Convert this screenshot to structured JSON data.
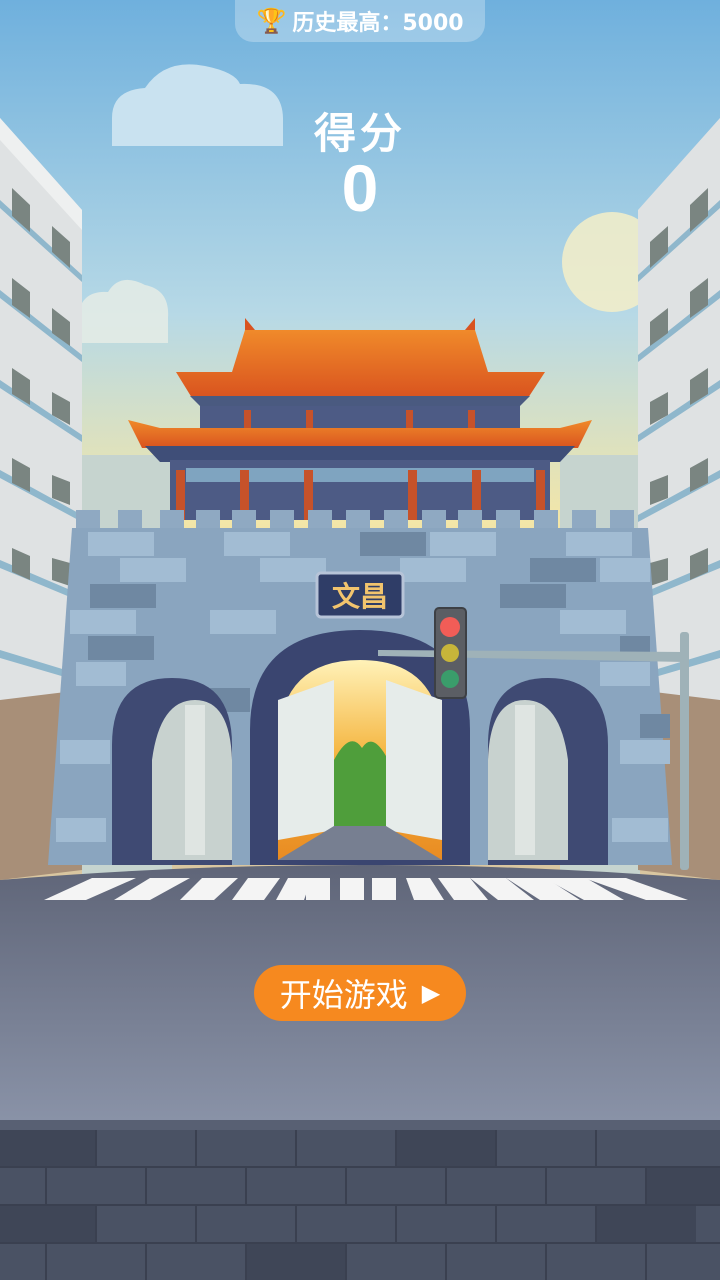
{
  "hud": {
    "best_label": "历史最高：5000",
    "score_label": "得分",
    "score_value": "0"
  },
  "gate": {
    "plaque_text": "文昌"
  },
  "buttons": {
    "start_label": "开始游戏"
  },
  "icons": {
    "best": "trophy-icon",
    "start": "play-icon"
  },
  "colors": {
    "sky_top": "#6fb0dd",
    "sky_bottom": "#f3e6a8",
    "roof": "#e0612a",
    "wall": "#8fa9c2",
    "road": "#6f7688",
    "button": "#f6891f"
  }
}
